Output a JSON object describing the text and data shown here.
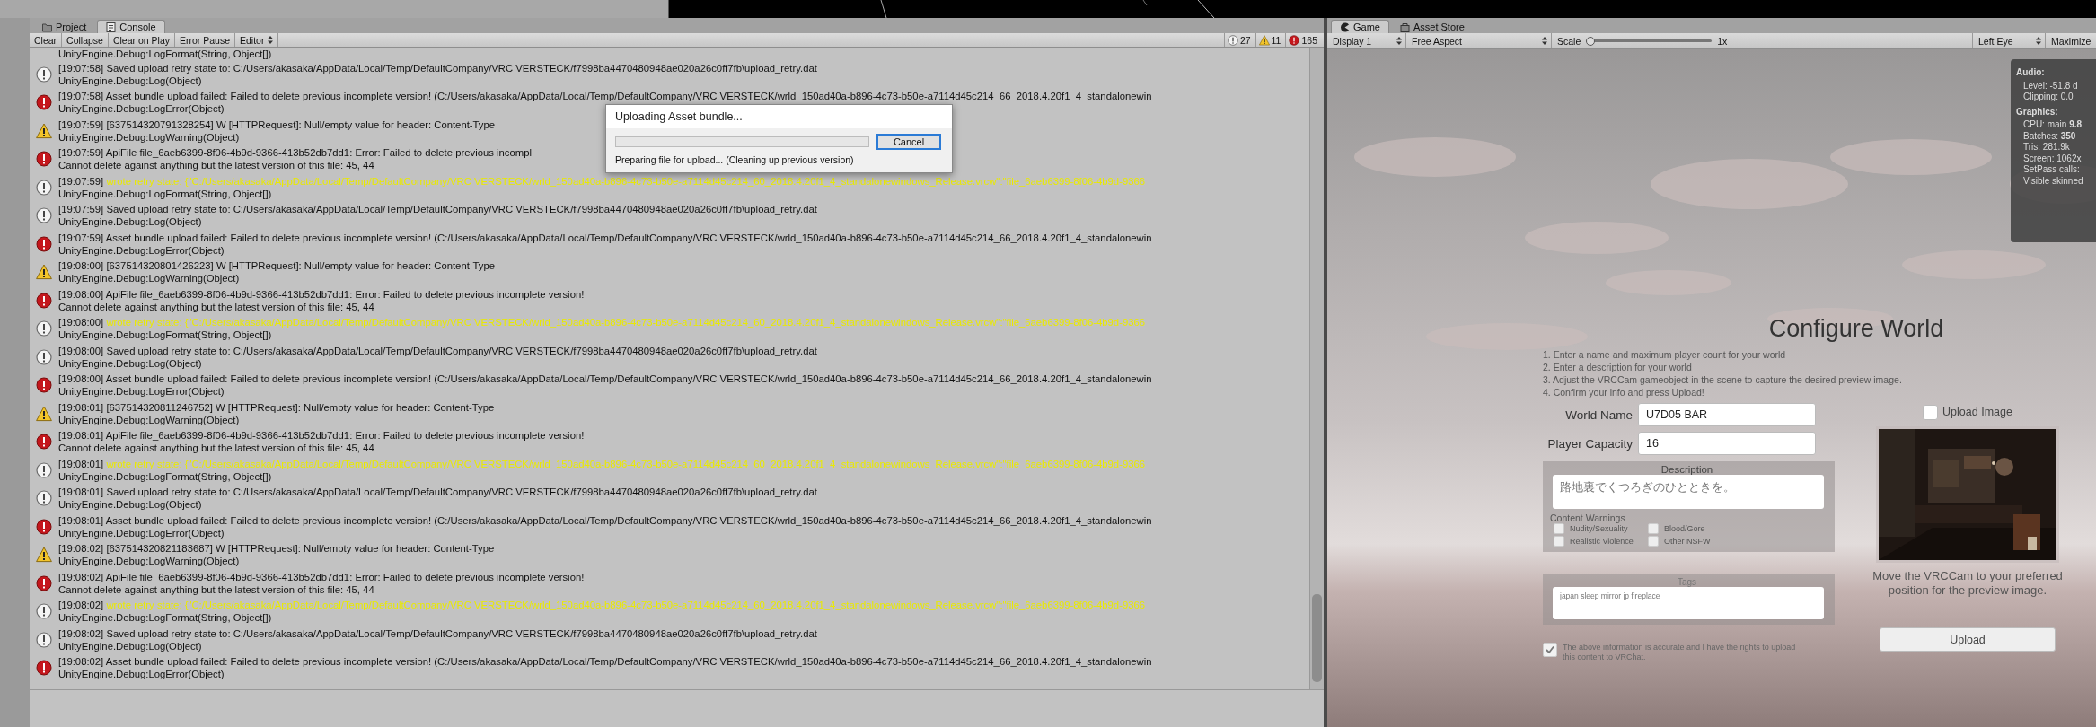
{
  "console": {
    "tabs": [
      {
        "label": "Project",
        "selected": false
      },
      {
        "label": "Console",
        "selected": true
      }
    ],
    "toolbar": {
      "buttons": [
        "Clear",
        "Collapse",
        "Clear on Play",
        "Error Pause"
      ],
      "dropdown": "Editor",
      "counts": [
        {
          "kind": "info",
          "count": "27"
        },
        {
          "kind": "warning",
          "count": "11"
        },
        {
          "kind": "error",
          "count": "165"
        }
      ]
    },
    "entries": [
      {
        "kind": "partial",
        "detail": "UnityEngine.Debug:LogFormat(String, Object[])"
      },
      {
        "kind": "info",
        "time": "[19:07:58]",
        "message": "Saved upload retry state to: C:/Users/akasaka/AppData/Local/Temp/DefaultCompany/VRC VERSTECK/f7998ba4470480948ae020a26c0ff7fb\\upload_retry.dat",
        "highlighted": false,
        "detail": "UnityEngine.Debug:Log(Object)"
      },
      {
        "kind": "error",
        "time": "[19:07:58]",
        "message": "Asset bundle upload failed: Failed to delete previous incomplete version! (C:/Users/akasaka/AppData/Local/Temp/DefaultCompany/VRC VERSTECK/wrld_150ad40a-b896-4c73-b50e-a7114d45c214_66_2018.4.20f1_4_standalonewin",
        "highlighted": false,
        "detail": "UnityEngine.Debug:LogError(Object)"
      },
      {
        "kind": "warning",
        "time": "[19:07:59]",
        "message": "[637514320791328254] W [HTTPRequest]: Null/empty value for header: Content-Type",
        "highlighted": false,
        "detail": "UnityEngine.Debug:LogWarning(Object)"
      },
      {
        "kind": "error",
        "time": "[19:07:59]",
        "message": "ApiFile file_6aeb6399-8f06-4b9d-9366-413b52db7dd1: Error: Failed to delete previous incompl",
        "highlighted": false,
        "detail": "Cannot delete against anything but the latest version of this file: 45, 44"
      },
      {
        "kind": "info",
        "time": "[19:07:59]",
        "message": "wrote retry state: {\"C:/Users/akasaka/AppData/Local/Temp/DefaultCompany/VRC VERSTECK/wrld_150ad40a-b896-4c73-b50e-a7114d45c214_60_2018.4.20f1_4_standalonewindows_Release.vrcw\":\"file_6aeb6399-8f06-4b9d-9366",
        "highlighted": true,
        "detail": "UnityEngine.Debug:LogFormat(String, Object[])"
      },
      {
        "kind": "info",
        "time": "[19:07:59]",
        "message": "Saved upload retry state to: C:/Users/akasaka/AppData/Local/Temp/DefaultCompany/VRC VERSTECK/f7998ba4470480948ae020a26c0ff7fb\\upload_retry.dat",
        "highlighted": false,
        "detail": "UnityEngine.Debug:Log(Object)"
      },
      {
        "kind": "error",
        "time": "[19:07:59]",
        "message": "Asset bundle upload failed: Failed to delete previous incomplete version! (C:/Users/akasaka/AppData/Local/Temp/DefaultCompany/VRC VERSTECK/wrld_150ad40a-b896-4c73-b50e-a7114d45c214_66_2018.4.20f1_4_standalonewin",
        "highlighted": false,
        "detail": "UnityEngine.Debug:LogError(Object)"
      },
      {
        "kind": "warning",
        "time": "[19:08:00]",
        "message": "[637514320801426223] W [HTTPRequest]: Null/empty value for header: Content-Type",
        "highlighted": false,
        "detail": "UnityEngine.Debug:LogWarning(Object)"
      },
      {
        "kind": "error",
        "time": "[19:08:00]",
        "message": "ApiFile file_6aeb6399-8f06-4b9d-9366-413b52db7dd1: Error: Failed to delete previous incomplete version!",
        "highlighted": false,
        "detail": "Cannot delete against anything but the latest version of this file: 45, 44"
      },
      {
        "kind": "info",
        "time": "[19:08:00]",
        "message": "wrote retry state: {\"C:/Users/akasaka/AppData/Local/Temp/DefaultCompany/VRC VERSTECK/wrld_150ad40a-b896-4c73-b50e-a7114d45c214_60_2018.4.20f1_4_standalonewindows_Release.vrcw\":\"file_6aeb6399-8f06-4b9d-9366",
        "highlighted": true,
        "detail": "UnityEngine.Debug:LogFormat(String, Object[])"
      },
      {
        "kind": "info",
        "time": "[19:08:00]",
        "message": "Saved upload retry state to: C:/Users/akasaka/AppData/Local/Temp/DefaultCompany/VRC VERSTECK/f7998ba4470480948ae020a26c0ff7fb\\upload_retry.dat",
        "highlighted": false,
        "detail": "UnityEngine.Debug:Log(Object)"
      },
      {
        "kind": "error",
        "time": "[19:08:00]",
        "message": "Asset bundle upload failed: Failed to delete previous incomplete version! (C:/Users/akasaka/AppData/Local/Temp/DefaultCompany/VRC VERSTECK/wrld_150ad40a-b896-4c73-b50e-a7114d45c214_66_2018.4.20f1_4_standalonewin",
        "highlighted": false,
        "detail": "UnityEngine.Debug:LogError(Object)"
      },
      {
        "kind": "warning",
        "time": "[19:08:01]",
        "message": "[637514320811246752] W [HTTPRequest]: Null/empty value for header: Content-Type",
        "highlighted": false,
        "detail": "UnityEngine.Debug:LogWarning(Object)"
      },
      {
        "kind": "error",
        "time": "[19:08:01]",
        "message": "ApiFile file_6aeb6399-8f06-4b9d-9366-413b52db7dd1: Error: Failed to delete previous incomplete version!",
        "highlighted": false,
        "detail": "Cannot delete against anything but the latest version of this file: 45, 44"
      },
      {
        "kind": "info",
        "time": "[19:08:01]",
        "message": "wrote retry state: {\"C:/Users/akasaka/AppData/Local/Temp/DefaultCompany/VRC VERSTECK/wrld_150ad40a-b896-4c73-b50e-a7114d45c214_60_2018.4.20f1_4_standalonewindows_Release.vrcw\":\"file_6aeb6399-8f06-4b9d-9366",
        "highlighted": true,
        "detail": "UnityEngine.Debug:LogFormat(String, Object[])"
      },
      {
        "kind": "info",
        "time": "[19:08:01]",
        "message": "Saved upload retry state to: C:/Users/akasaka/AppData/Local/Temp/DefaultCompany/VRC VERSTECK/f7998ba4470480948ae020a26c0ff7fb\\upload_retry.dat",
        "highlighted": false,
        "detail": "UnityEngine.Debug:Log(Object)"
      },
      {
        "kind": "error",
        "time": "[19:08:01]",
        "message": "Asset bundle upload failed: Failed to delete previous incomplete version! (C:/Users/akasaka/AppData/Local/Temp/DefaultCompany/VRC VERSTECK/wrld_150ad40a-b896-4c73-b50e-a7114d45c214_66_2018.4.20f1_4_standalonewin",
        "highlighted": false,
        "detail": "UnityEngine.Debug:LogError(Object)"
      },
      {
        "kind": "warning",
        "time": "[19:08:02]",
        "message": "[637514320821183687] W [HTTPRequest]: Null/empty value for header: Content-Type",
        "highlighted": false,
        "detail": "UnityEngine.Debug:LogWarning(Object)"
      },
      {
        "kind": "error",
        "time": "[19:08:02]",
        "message": "ApiFile file_6aeb6399-8f06-4b9d-9366-413b52db7dd1: Error: Failed to delete previous incomplete version!",
        "highlighted": false,
        "detail": "Cannot delete against anything but the latest version of this file: 45, 44"
      },
      {
        "kind": "info",
        "time": "[19:08:02]",
        "message": "wrote retry state: {\"C:/Users/akasaka/AppData/Local/Temp/DefaultCompany/VRC VERSTECK/wrld_150ad40a-b896-4c73-b50e-a7114d45c214_60_2018.4.20f1_4_standalonewindows_Release.vrcw\":\"file_6aeb6399-8f06-4b9d-9366",
        "highlighted": true,
        "detail": "UnityEngine.Debug:LogFormat(String, Object[])"
      },
      {
        "kind": "info",
        "time": "[19:08:02]",
        "message": "Saved upload retry state to: C:/Users/akasaka/AppData/Local/Temp/DefaultCompany/VRC VERSTECK/f7998ba4470480948ae020a26c0ff7fb\\upload_retry.dat",
        "highlighted": false,
        "detail": "UnityEngine.Debug:Log(Object)"
      },
      {
        "kind": "error",
        "time": "[19:08:02]",
        "message": "Asset bundle upload failed: Failed to delete previous incomplete version! (C:/Users/akasaka/AppData/Local/Temp/DefaultCompany/VRC VERSTECK/wrld_150ad40a-b896-4c73-b50e-a7114d45c214_66_2018.4.20f1_4_standalonewin",
        "highlighted": false,
        "detail": "UnityEngine.Debug:LogError(Object)"
      }
    ]
  },
  "dialog": {
    "title": "Uploading Asset bundle...",
    "level": 0,
    "status": "Preparing file for upload... (Cleaning up previous version)",
    "button": "Cancel"
  },
  "game": {
    "tabs": [
      {
        "label": "Game",
        "selected": true
      },
      {
        "label": "Asset Store",
        "selected": false
      }
    ],
    "toolbar": {
      "display": "Display 1",
      "aspect": "Free Aspect",
      "scale_label": "Scale",
      "scale": {
        "level": 0
      },
      "scale_value": "1x",
      "eye": "Left Eye",
      "maximize": "Maximize"
    },
    "stats": [
      {
        "kind": "heading",
        "text": "Audio:"
      },
      {
        "kind": "line",
        "text": "Level: -51.8 d"
      },
      {
        "kind": "line",
        "text": "Clipping: 0.0"
      },
      {
        "kind": "heading",
        "text": "Graphics:"
      },
      {
        "kind": "line",
        "text": "CPU: main **9.8**"
      },
      {
        "kind": "line",
        "text": "Batches: **350**"
      },
      {
        "kind": "line",
        "text": "Tris: 281.9k"
      },
      {
        "kind": "line",
        "text": "Screen: 1062x"
      },
      {
        "kind": "line",
        "text": "SetPass calls:"
      },
      {
        "kind": "line",
        "text": "Visible skinned"
      }
    ],
    "configure_world": {
      "title": "Configure World",
      "instructions": [
        "1. Enter a name and maximum player count for your world",
        "2. Enter a description for your world",
        "3. Adjust the VRCCam gameobject in the scene to capture the desired preview image.",
        "4. Confirm your info and press Upload!"
      ],
      "fields": [
        {
          "label": "World Name",
          "value": "U7D05 BAR"
        },
        {
          "label": "Player Capacity",
          "value": "16"
        }
      ],
      "description": {
        "label": "Description",
        "value": "路地裏でくつろぎのひとときを。"
      },
      "content_warnings": {
        "label": "Content Warnings",
        "options": [
          {
            "label": "Nudity/Sexuality",
            "checked": false
          },
          {
            "label": "Blood/Gore",
            "checked": false
          },
          {
            "label": "Realistic Violence",
            "checked": false
          },
          {
            "label": "Other NSFW",
            "checked": false
          }
        ]
      },
      "tags": {
        "label": "Tags",
        "value": "japan sleep mirror jp fireplace"
      },
      "agreement": {
        "text": "The above information is accurate and I have the rights to upload this content to VRChat.",
        "checked": true
      },
      "upload_image": {
        "label": "Upload Image",
        "checked": false
      },
      "caption": "Move the VRCCam to your preferred position for the preview image.",
      "upload_button": "Upload"
    }
  }
}
